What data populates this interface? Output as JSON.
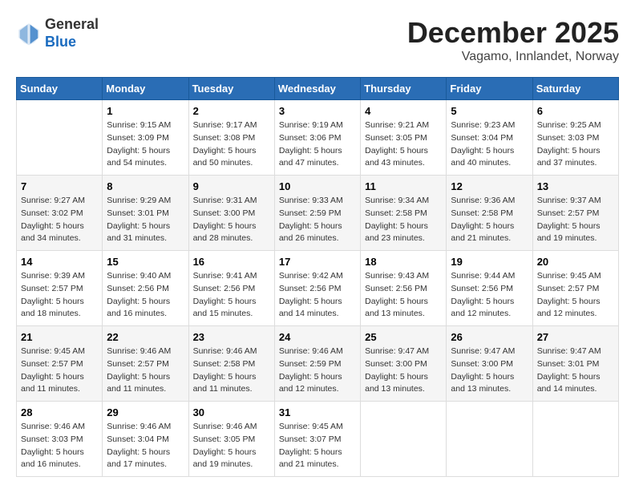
{
  "header": {
    "logo_general": "General",
    "logo_blue": "Blue",
    "month": "December 2025",
    "location": "Vagamo, Innlandet, Norway"
  },
  "days_of_week": [
    "Sunday",
    "Monday",
    "Tuesday",
    "Wednesday",
    "Thursday",
    "Friday",
    "Saturday"
  ],
  "weeks": [
    [
      {
        "day": "",
        "info": ""
      },
      {
        "day": "1",
        "info": "Sunrise: 9:15 AM\nSunset: 3:09 PM\nDaylight: 5 hours\nand 54 minutes."
      },
      {
        "day": "2",
        "info": "Sunrise: 9:17 AM\nSunset: 3:08 PM\nDaylight: 5 hours\nand 50 minutes."
      },
      {
        "day": "3",
        "info": "Sunrise: 9:19 AM\nSunset: 3:06 PM\nDaylight: 5 hours\nand 47 minutes."
      },
      {
        "day": "4",
        "info": "Sunrise: 9:21 AM\nSunset: 3:05 PM\nDaylight: 5 hours\nand 43 minutes."
      },
      {
        "day": "5",
        "info": "Sunrise: 9:23 AM\nSunset: 3:04 PM\nDaylight: 5 hours\nand 40 minutes."
      },
      {
        "day": "6",
        "info": "Sunrise: 9:25 AM\nSunset: 3:03 PM\nDaylight: 5 hours\nand 37 minutes."
      }
    ],
    [
      {
        "day": "7",
        "info": "Sunrise: 9:27 AM\nSunset: 3:02 PM\nDaylight: 5 hours\nand 34 minutes."
      },
      {
        "day": "8",
        "info": "Sunrise: 9:29 AM\nSunset: 3:01 PM\nDaylight: 5 hours\nand 31 minutes."
      },
      {
        "day": "9",
        "info": "Sunrise: 9:31 AM\nSunset: 3:00 PM\nDaylight: 5 hours\nand 28 minutes."
      },
      {
        "day": "10",
        "info": "Sunrise: 9:33 AM\nSunset: 2:59 PM\nDaylight: 5 hours\nand 26 minutes."
      },
      {
        "day": "11",
        "info": "Sunrise: 9:34 AM\nSunset: 2:58 PM\nDaylight: 5 hours\nand 23 minutes."
      },
      {
        "day": "12",
        "info": "Sunrise: 9:36 AM\nSunset: 2:58 PM\nDaylight: 5 hours\nand 21 minutes."
      },
      {
        "day": "13",
        "info": "Sunrise: 9:37 AM\nSunset: 2:57 PM\nDaylight: 5 hours\nand 19 minutes."
      }
    ],
    [
      {
        "day": "14",
        "info": "Sunrise: 9:39 AM\nSunset: 2:57 PM\nDaylight: 5 hours\nand 18 minutes."
      },
      {
        "day": "15",
        "info": "Sunrise: 9:40 AM\nSunset: 2:56 PM\nDaylight: 5 hours\nand 16 minutes."
      },
      {
        "day": "16",
        "info": "Sunrise: 9:41 AM\nSunset: 2:56 PM\nDaylight: 5 hours\nand 15 minutes."
      },
      {
        "day": "17",
        "info": "Sunrise: 9:42 AM\nSunset: 2:56 PM\nDaylight: 5 hours\nand 14 minutes."
      },
      {
        "day": "18",
        "info": "Sunrise: 9:43 AM\nSunset: 2:56 PM\nDaylight: 5 hours\nand 13 minutes."
      },
      {
        "day": "19",
        "info": "Sunrise: 9:44 AM\nSunset: 2:56 PM\nDaylight: 5 hours\nand 12 minutes."
      },
      {
        "day": "20",
        "info": "Sunrise: 9:45 AM\nSunset: 2:57 PM\nDaylight: 5 hours\nand 12 minutes."
      }
    ],
    [
      {
        "day": "21",
        "info": "Sunrise: 9:45 AM\nSunset: 2:57 PM\nDaylight: 5 hours\nand 11 minutes."
      },
      {
        "day": "22",
        "info": "Sunrise: 9:46 AM\nSunset: 2:57 PM\nDaylight: 5 hours\nand 11 minutes."
      },
      {
        "day": "23",
        "info": "Sunrise: 9:46 AM\nSunset: 2:58 PM\nDaylight: 5 hours\nand 11 minutes."
      },
      {
        "day": "24",
        "info": "Sunrise: 9:46 AM\nSunset: 2:59 PM\nDaylight: 5 hours\nand 12 minutes."
      },
      {
        "day": "25",
        "info": "Sunrise: 9:47 AM\nSunset: 3:00 PM\nDaylight: 5 hours\nand 13 minutes."
      },
      {
        "day": "26",
        "info": "Sunrise: 9:47 AM\nSunset: 3:00 PM\nDaylight: 5 hours\nand 13 minutes."
      },
      {
        "day": "27",
        "info": "Sunrise: 9:47 AM\nSunset: 3:01 PM\nDaylight: 5 hours\nand 14 minutes."
      }
    ],
    [
      {
        "day": "28",
        "info": "Sunrise: 9:46 AM\nSunset: 3:03 PM\nDaylight: 5 hours\nand 16 minutes."
      },
      {
        "day": "29",
        "info": "Sunrise: 9:46 AM\nSunset: 3:04 PM\nDaylight: 5 hours\nand 17 minutes."
      },
      {
        "day": "30",
        "info": "Sunrise: 9:46 AM\nSunset: 3:05 PM\nDaylight: 5 hours\nand 19 minutes."
      },
      {
        "day": "31",
        "info": "Sunrise: 9:45 AM\nSunset: 3:07 PM\nDaylight: 5 hours\nand 21 minutes."
      },
      {
        "day": "",
        "info": ""
      },
      {
        "day": "",
        "info": ""
      },
      {
        "day": "",
        "info": ""
      }
    ]
  ]
}
